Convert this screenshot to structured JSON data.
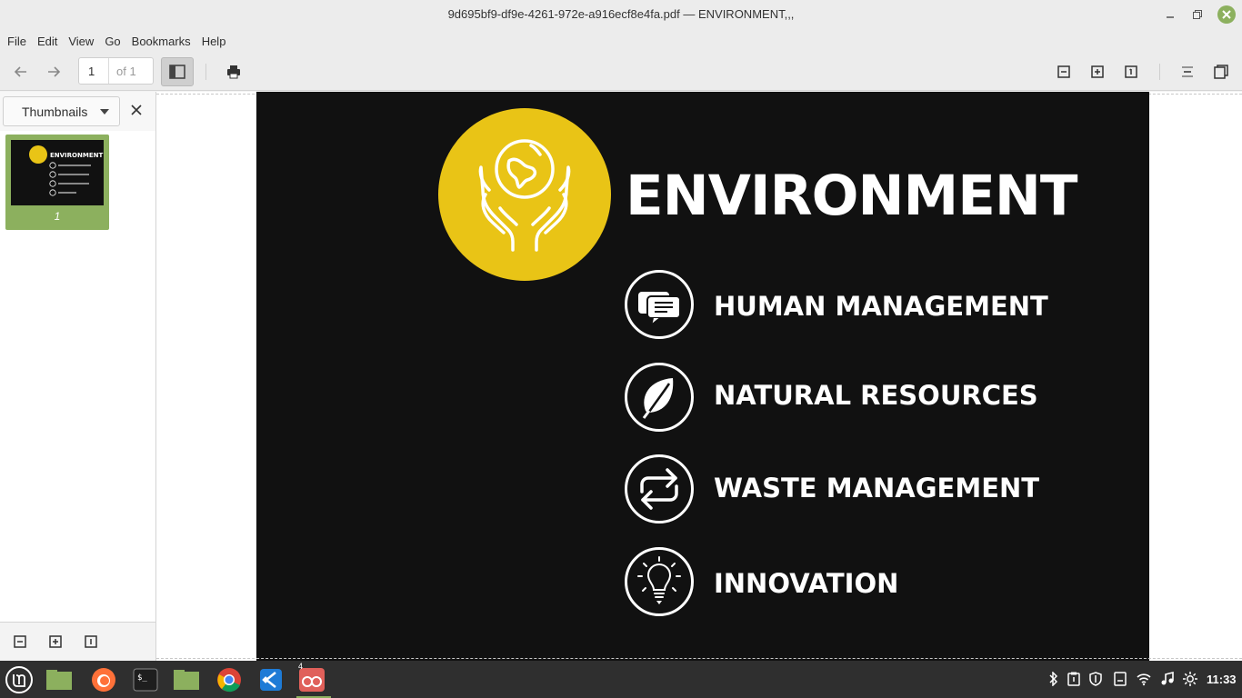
{
  "window": {
    "title": "9d695bf9-df9e-4261-972e-a916ecf8e4fa.pdf — ENVIRONMENT,,,"
  },
  "menu": [
    "File",
    "Edit",
    "View",
    "Go",
    "Bookmarks",
    "Help"
  ],
  "toolbar": {
    "page_current": "1",
    "page_of": "of 1",
    "icons": [
      "back-arrow-icon",
      "forward-arrow-icon",
      "sidebar-icon",
      "print-icon",
      "zoom-out-icon",
      "zoom-in-icon",
      "zoom-reset-icon",
      "page-layout-icon",
      "fullscreen-icon"
    ]
  },
  "sidebar": {
    "mode": "Thumbnails",
    "thumbnails": [
      {
        "label": "1"
      }
    ],
    "thumb_text": {
      "title": "ENVIRONMENT"
    }
  },
  "document": {
    "heading": "ENVIRONMENT",
    "items": [
      {
        "label": "HUMAN MANAGEMENT",
        "icon": "chat-bubbles-icon"
      },
      {
        "label": "NATURAL RESOURCES",
        "icon": "leaf-icon"
      },
      {
        "label": "WASTE MANAGEMENT",
        "icon": "recycle-arrows-icon"
      },
      {
        "label": "INNOVATION",
        "icon": "lightbulb-icon"
      }
    ],
    "badge_icon": "hands-globe-icon",
    "colors": {
      "badge": "#e9c416",
      "page": "#111111"
    }
  },
  "taskbar": {
    "apps": [
      "mint-menu-icon",
      "show-desktop-icon",
      "firefox-icon",
      "terminal-icon",
      "files-icon",
      "chrome-icon",
      "vscode-icon",
      "document-viewer-icon"
    ],
    "badge_count": "4",
    "tray": [
      "bluetooth-icon",
      "clipboard-icon",
      "shield-icon",
      "notes-icon",
      "wifi-icon",
      "music-icon",
      "brightness-icon"
    ],
    "clock": "11:33"
  },
  "accent": "#8cb05e"
}
